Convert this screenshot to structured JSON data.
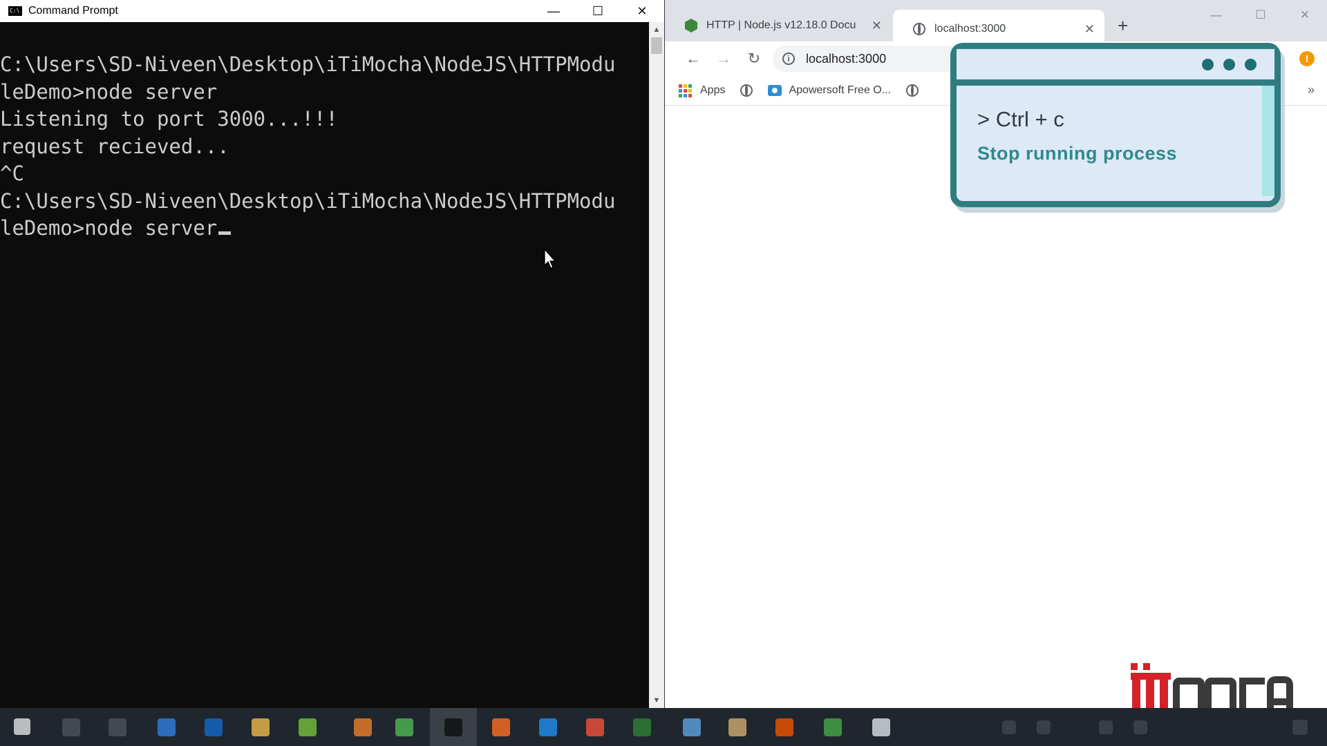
{
  "cmd": {
    "title": "Command Prompt",
    "icon_label": "C:\\",
    "lines": [
      "C:\\Users\\SD-Niveen\\Desktop\\iTiMocha\\NodeJS\\HTTPModu",
      "leDemo>node server",
      "Listening to port 3000...!!!",
      "request recieved...",
      "^C",
      "C:\\Users\\SD-Niveen\\Desktop\\iTiMocha\\NodeJS\\HTTPModu",
      "leDemo>node server"
    ],
    "window_controls": {
      "minimize": "—",
      "maximize": "☐",
      "close": "✕"
    }
  },
  "browser": {
    "tabs": [
      {
        "title": "HTTP | Node.js v12.18.0 Docu",
        "favicon": "nodejs-hex-icon",
        "active": false
      },
      {
        "title": "localhost:3000",
        "favicon": "globe-icon",
        "active": true
      }
    ],
    "new_tab": "+",
    "url": "localhost:3000",
    "update_badge": "!",
    "bookmarks": [
      {
        "label": "Apps",
        "icon": "apps-grid-icon"
      },
      {
        "label": "",
        "icon": "globe-icon"
      },
      {
        "label": "Apowersoft Free O...",
        "icon": "apowersoft-icon"
      },
      {
        "label": "",
        "icon": "globe-icon"
      }
    ],
    "bookmarks_more": "»"
  },
  "overlay": {
    "command": "> Ctrl + c",
    "description": "Stop running process"
  },
  "logo": {
    "text": "MOOCA"
  },
  "colors": {
    "overlay_border": "#2f7d80",
    "overlay_bg": "#dde9f7",
    "overlay_text_accent": "#2f8a8c",
    "logo_red": "#d32228",
    "terminal_bg": "#0c0c0c",
    "terminal_fg": "#cccccc"
  }
}
